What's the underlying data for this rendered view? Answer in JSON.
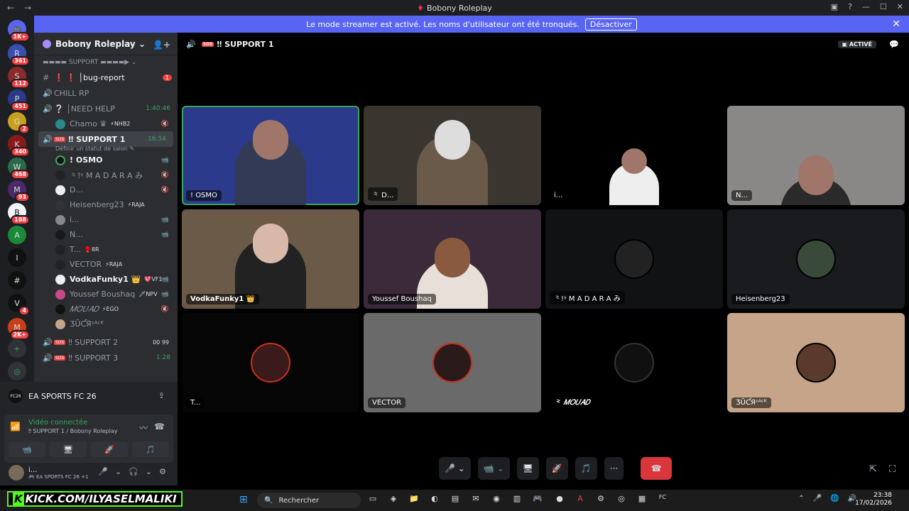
{
  "window": {
    "title": "Bobony Roleplay",
    "back": "←",
    "forward": "→",
    "controls": [
      "▣",
      "?",
      "—",
      "☐",
      "✕"
    ]
  },
  "banner": {
    "text": "Le mode streamer est activé. Les noms d'utilisateur ont été tronqués.",
    "button": "Désactiver",
    "close": "✕"
  },
  "servers": [
    {
      "label": "🎮",
      "badge": "1K+"
    },
    {
      "label": "R",
      "badge": "361"
    },
    {
      "label": "S",
      "badge": "112"
    },
    {
      "label": "P",
      "badge": "451"
    },
    {
      "label": "G",
      "badge": "2"
    },
    {
      "label": "K",
      "badge": "340"
    },
    {
      "label": "W",
      "badge": "468"
    },
    {
      "label": "M",
      "badge": "93"
    },
    {
      "label": "B",
      "badge": "188"
    },
    {
      "label": "A",
      "badge": ""
    },
    {
      "label": "I",
      "badge": ""
    },
    {
      "label": "#",
      "badge": ""
    },
    {
      "label": "V",
      "badge": "4"
    },
    {
      "label": "M",
      "badge": "2K+"
    },
    {
      "label": "+",
      "badge": ""
    },
    {
      "label": "◎",
      "badge": ""
    }
  ],
  "guild": {
    "name": "Bobony Roleplay",
    "chevron": "⌄",
    "invite_icon": "👤+"
  },
  "sidebar": {
    "category": "▬▬▬▬ SUPPORT ▬▬▬▬▶ ⌄",
    "bug_report": {
      "icon": "#",
      "name": "❗ ❗ │bug-report",
      "badge": "1"
    },
    "chill": {
      "icon": "🔊",
      "name": "CHILL RP"
    },
    "need_help": {
      "icon": "🔊",
      "name": "❔ │NEED HELP",
      "time": "1:40:46"
    },
    "need_help_users": [
      {
        "name": "Chamo ♛",
        "badge": "⚡NHB2",
        "status": "🔇"
      }
    ],
    "support1": {
      "icon": "🔊",
      "tag": "SOS",
      "name": "‼ SUPPORT 1",
      "time": "16:54",
      "sub": "Définir un statut de salon ✎"
    },
    "support1_users": [
      {
        "name": "! OSMO",
        "badge": "",
        "status": "📹"
      },
      {
        "name": "⺀!ᵞ M A D A R A み",
        "badge": "",
        "status": "🔇"
      },
      {
        "name": "D...",
        "badge": "",
        "status": "🔇"
      },
      {
        "name": "Heisenberg23",
        "badge": "⚡RAJA",
        "status": ""
      },
      {
        "name": "i...",
        "badge": "",
        "status": "📹"
      },
      {
        "name": "N...",
        "badge": "",
        "status": "📹"
      },
      {
        "name": "T...",
        "badge": "🥊8R",
        "status": ""
      },
      {
        "name": "VECTOR",
        "badge": "⚡RAJA",
        "status": ""
      },
      {
        "name": "VodkaFunky1 👑",
        "badge": "💖VF1",
        "status": "📹"
      },
      {
        "name": "Youssef Boushaq",
        "badge": "🗡NPV",
        "status": "📹"
      },
      {
        "name": "𝑀𝑂𝑈𝐴𝐷",
        "badge": "⚡EGO",
        "status": "🔇"
      },
      {
        "name": "ƷŬƇЯᶻᴬᶜᴷ",
        "badge": "",
        "status": ""
      }
    ],
    "support2": {
      "icon": "🔊",
      "tag": "SOS",
      "name": "‼ SUPPORT 2",
      "count_a": "00",
      "count_b": "99"
    },
    "support3": {
      "icon": "🔊",
      "tag": "SOS",
      "name": "‼ SUPPORT 3",
      "time": "1:28"
    }
  },
  "activity": {
    "game": "EA SPORTS FC 26",
    "game_icon": "FC26",
    "share_icon": "⇪"
  },
  "voice": {
    "status": "Vidéo connectée",
    "where": "‼ SUPPORT 1 / Bobony Roleplay",
    "signal": "📶",
    "noise": "〰",
    "disconnect": "☎",
    "actions": [
      "📹",
      "🖥",
      "🚀",
      "🎵"
    ]
  },
  "user": {
    "name": "i...",
    "activity": "🎮 EA SPORTS FC 26 +1",
    "controls": [
      "🎤",
      "⌄",
      "🎧",
      "⌄",
      "⚙"
    ]
  },
  "stage": {
    "speaker": "🔊",
    "tag": "SOS",
    "channel": "‼ SUPPORT 1",
    "active": "▣ ACTIVÉ",
    "chat_icon": "💬"
  },
  "tiles": [
    {
      "name": "! OSMO",
      "kind": "video",
      "bg": "#2b3a8a",
      "speaking": true
    },
    {
      "name": "⺀ D...",
      "kind": "video",
      "bg": "#3b3530",
      "speaking": false
    },
    {
      "name": "i...",
      "kind": "video",
      "bg": "#000000",
      "speaking": false
    },
    {
      "name": "N...",
      "kind": "video",
      "bg": "#8a8886",
      "speaking": false
    },
    {
      "name": "VodkaFunky1 👑",
      "kind": "video",
      "bg": "#6b5a48",
      "speaking": false
    },
    {
      "name": "Youssef Boushaq",
      "kind": "video",
      "bg": "#3a2a3a",
      "speaking": false
    },
    {
      "name": "⺀!ᵞ M A D A R A み",
      "kind": "avatar",
      "bg": "#111214",
      "speaking": false
    },
    {
      "name": "Heisenberg23",
      "kind": "avatar",
      "bg": "#1a1b1e",
      "speaking": false
    },
    {
      "name": "T...",
      "kind": "avatar",
      "bg": "#050505",
      "speaking": false
    },
    {
      "name": "VECTOR",
      "kind": "avatar",
      "bg": "#6a6a6a",
      "speaking": false
    },
    {
      "name": "⺀ 𝑀𝑂𝑈𝐴𝐷",
      "kind": "avatar",
      "bg": "#000000",
      "speaking": false
    },
    {
      "name": "ƷŬƇЯᶻᴬᶜᴷ",
      "kind": "avatar",
      "bg": "#c5a48a",
      "speaking": false
    }
  ],
  "callbar": {
    "mic": "🎤 ⌄",
    "cam": "📹 ⌄",
    "share": "🖥",
    "activity": "🚀",
    "soundboard": "🎵",
    "more": "···",
    "hangup": "☎",
    "popout": "⇱",
    "fullscreen": "⛶"
  },
  "taskbar": {
    "kick_k": "K",
    "kick": "KICK.COM/ILYASELMALIKI",
    "start": "⊞",
    "search_icon": "🔍",
    "search": "Rechercher",
    "apps": [
      "▭",
      "◈",
      "📁",
      "◐",
      "▤",
      "✉",
      "◉",
      "▥",
      "🎮",
      "●",
      "A",
      "⚙",
      "◎",
      "▦",
      "FC"
    ],
    "tray": [
      "⌃",
      "🎤",
      "🌐",
      "🔊"
    ],
    "time": "23:38",
    "date": "17/02/2026"
  }
}
